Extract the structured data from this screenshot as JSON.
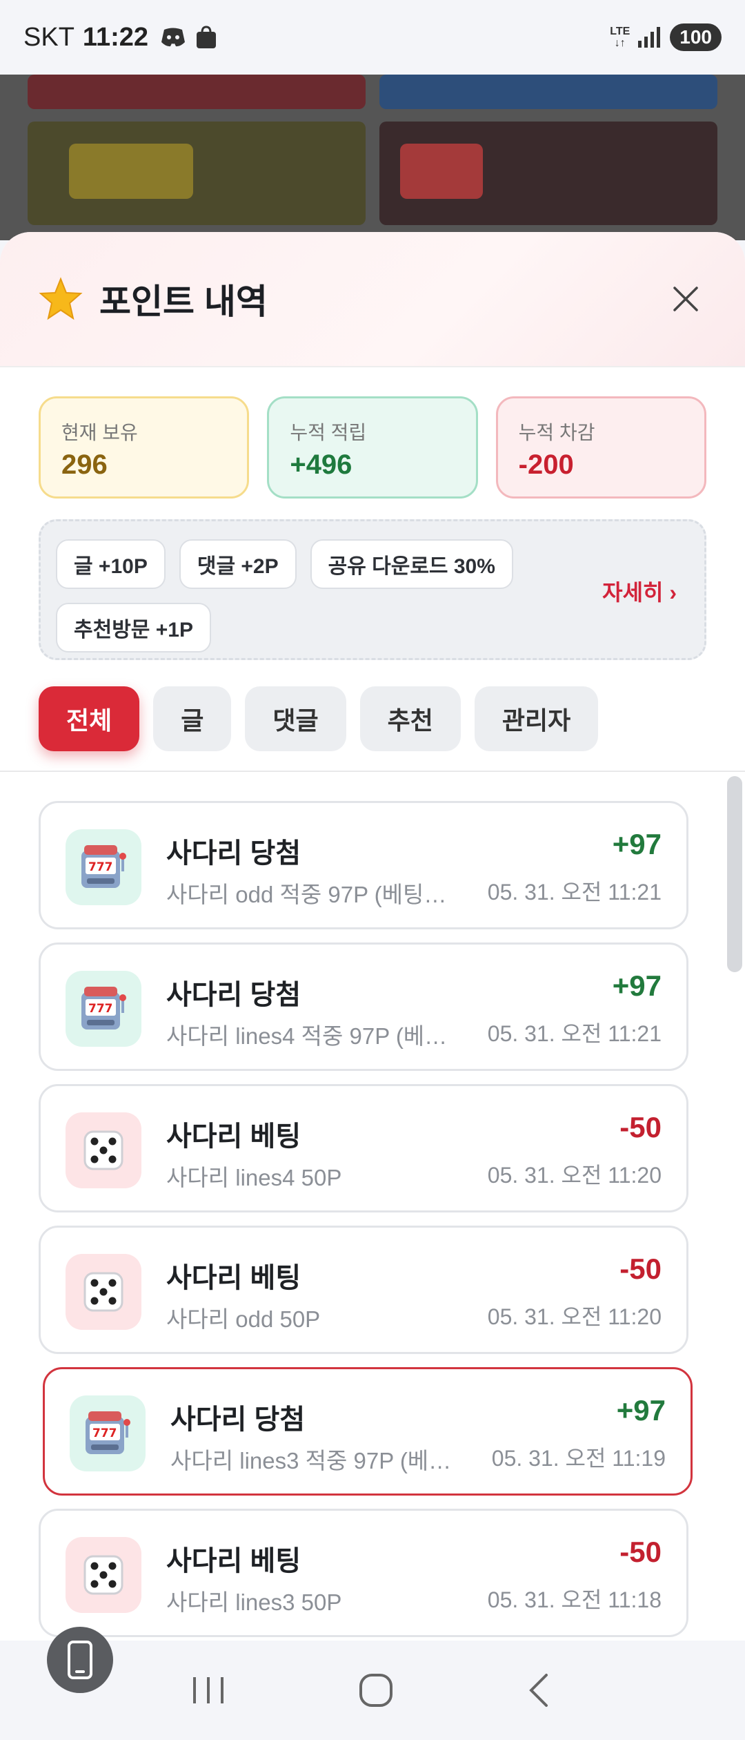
{
  "status_bar": {
    "carrier": "SKT",
    "time": "11:22",
    "network_top": "LTE",
    "network_bottom": "↓↑",
    "battery": "100"
  },
  "sheet": {
    "title": "포인트 내역",
    "stats": {
      "current_label": "현재 보유",
      "current_value": "296",
      "earned_label": "누적 적립",
      "earned_value": "+496",
      "spent_label": "누적 차감",
      "spent_value": "-200"
    },
    "rules": {
      "chips": [
        "글 +10P",
        "댓글 +2P",
        "공유 다운로드 30%",
        "추천방문 +1P"
      ],
      "more_label": "자세히 ›"
    },
    "filters": [
      "전체",
      "글",
      "댓글",
      "추천",
      "관리자"
    ],
    "active_filter": "전체",
    "items": [
      {
        "type": "win",
        "title": "사다리 당첨",
        "desc": "사다리 odd 적중 97P (베팅…",
        "amount": "+97",
        "time": "05. 31. 오전 11:21"
      },
      {
        "type": "win",
        "title": "사다리 당첨",
        "desc": "사다리 lines4 적중 97P (베…",
        "amount": "+97",
        "time": "05. 31. 오전 11:21"
      },
      {
        "type": "bet",
        "title": "사다리 베팅",
        "desc": "사다리 lines4 50P",
        "amount": "-50",
        "time": "05. 31. 오전 11:20"
      },
      {
        "type": "bet",
        "title": "사다리 베팅",
        "desc": "사다리 odd 50P",
        "amount": "-50",
        "time": "05. 31. 오전 11:20"
      },
      {
        "type": "win",
        "title": "사다리 당첨",
        "desc": "사다리 lines3 적중 97P (베…",
        "amount": "+97",
        "time": "05. 31. 오전 11:19"
      },
      {
        "type": "bet",
        "title": "사다리 베팅",
        "desc": "사다리 lines3 50P",
        "amount": "-50",
        "time": "05. 31. 오전 11:18"
      }
    ]
  },
  "colors": {
    "accent": "#da2a38",
    "positive": "#227a3d",
    "negative": "#c3202f"
  },
  "icons": {
    "win": "slot-machine-icon",
    "bet": "dice-icon"
  }
}
